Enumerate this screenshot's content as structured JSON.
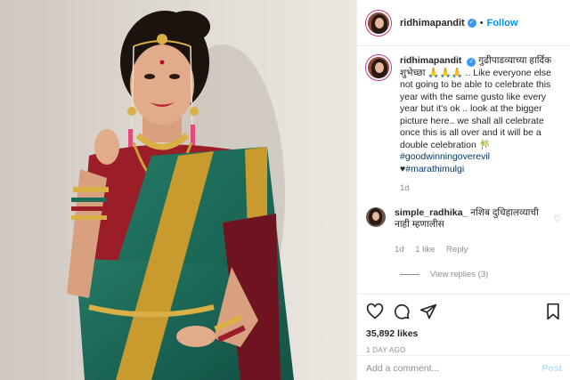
{
  "header": {
    "username": "ridhimapandit",
    "follow_label": "Follow",
    "separator": "•"
  },
  "caption": {
    "username": "ridhimapandit",
    "text": "गुढीपाडव्याच्या हार्दिक शुभेच्छा 🙏🙏🙏 .. Like everyone else not going to be able to celebrate this year with the same gusto like every year but it's ok .. look at the bigger picture here.. we shall all celebrate once this is all over and it will be a double celebration 🎋",
    "hashtag1": "#goodwinningoverevil",
    "hashtag2_prefix": "♥",
    "hashtag2": "#marathimulgi",
    "time": "1d"
  },
  "comment": {
    "username": "simple_radhika_",
    "text": "नशिब दुधिहालव्याची नाही म्हणालीस",
    "time": "1d",
    "likes": "1 like",
    "reply_label": "Reply",
    "view_replies": "View replies (3)"
  },
  "actions": {
    "likes": "35,892 likes",
    "ago": "1 DAY AGO"
  },
  "add_comment": {
    "placeholder": "Add a comment...",
    "post_label": "Post"
  },
  "colors": {
    "link": "#0095f6",
    "verified": "#3897f0",
    "muted": "#8e8e8e",
    "saree_green": "#1f6b5a",
    "saree_gold": "#c99a2e",
    "blouse_red": "#a0202a"
  }
}
